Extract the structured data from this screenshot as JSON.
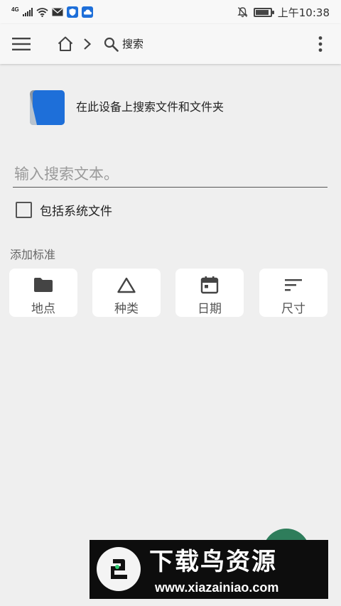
{
  "status_bar": {
    "network": "4G",
    "time": "上午10:38",
    "battery_level": 0.9,
    "icons": [
      "signal-icon",
      "wifi-icon",
      "mail-icon",
      "shield-icon",
      "cloud-icon",
      "mute-bell-icon",
      "battery-icon"
    ]
  },
  "app_bar": {
    "menu_icon": "hamburger-icon",
    "home_icon": "home-icon",
    "separator_icon": "chevron-right-icon",
    "crumb_icon": "search-icon",
    "crumb_label": "搜索",
    "more_icon": "more-vertical-icon"
  },
  "info": {
    "text": "在此设备上搜索文件和文件夹"
  },
  "search": {
    "placeholder": "输入搜索文本。",
    "value": ""
  },
  "include_system": {
    "label": "包括系统文件",
    "checked": false
  },
  "criteria": {
    "title": "添加标准",
    "items": [
      {
        "label": "地点",
        "icon": "folder-icon"
      },
      {
        "label": "种类",
        "icon": "triangle-icon"
      },
      {
        "label": "日期",
        "icon": "calendar-icon"
      },
      {
        "label": "尺寸",
        "icon": "sort-lines-icon"
      }
    ]
  },
  "colors": {
    "background": "#efefef",
    "accent_blue": "#1e6fd9",
    "fab_green": "#2e7d5b"
  },
  "watermark": {
    "title": "下载鸟资源",
    "url": "www.xiazainiao.com"
  }
}
